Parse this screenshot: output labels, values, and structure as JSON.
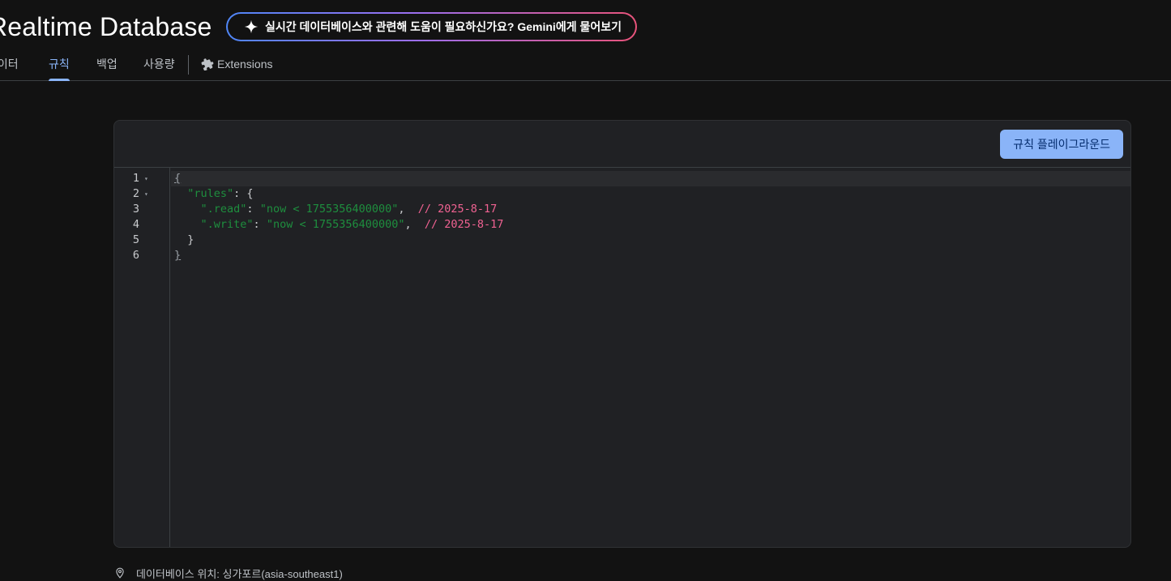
{
  "header": {
    "title": "Realtime Database",
    "gemini_prompt": {
      "icon": "sparkle-icon",
      "text": "실시간 데이터베이스와 관련해 도움이 필요하신가요? Gemini에게 물어보기"
    }
  },
  "tabs": [
    {
      "label": "데이터",
      "active": false
    },
    {
      "label": "규칙",
      "active": true
    },
    {
      "label": "백업",
      "active": false
    },
    {
      "label": "사용량",
      "active": false
    },
    {
      "label": "Extensions",
      "active": false,
      "icon": "puzzle-icon"
    }
  ],
  "toolbar": {
    "playground_label": "규칙 플레이그라운드"
  },
  "editor": {
    "line_numbers": [
      "1",
      "2",
      "3",
      "4",
      "5",
      "6"
    ],
    "foldable_lines": [
      1,
      2
    ],
    "current_line": 1,
    "lines": [
      [
        {
          "t": "{",
          "k": "brace"
        }
      ],
      [
        {
          "t": "  ",
          "k": "punc"
        },
        {
          "t": "\"rules\"",
          "k": "key"
        },
        {
          "t": ": {",
          "k": "punc"
        }
      ],
      [
        {
          "t": "    ",
          "k": "punc"
        },
        {
          "t": "\".read\"",
          "k": "key"
        },
        {
          "t": ": ",
          "k": "punc"
        },
        {
          "t": "\"now < 1755356400000\"",
          "k": "str"
        },
        {
          "t": ",  ",
          "k": "punc"
        },
        {
          "t": "// 2025-8-17",
          "k": "comment"
        }
      ],
      [
        {
          "t": "    ",
          "k": "punc"
        },
        {
          "t": "\".write\"",
          "k": "key"
        },
        {
          "t": ": ",
          "k": "punc"
        },
        {
          "t": "\"now < 1755356400000\"",
          "k": "str"
        },
        {
          "t": ",  ",
          "k": "punc"
        },
        {
          "t": "// 2025-8-17",
          "k": "comment"
        }
      ],
      [
        {
          "t": "  }",
          "k": "punc"
        }
      ],
      [
        {
          "t": "}",
          "k": "brace"
        }
      ]
    ]
  },
  "footer": {
    "icon": "location-pin-icon",
    "location_text": "데이터베이스 위치: 싱가포르(asia-southeast1)"
  },
  "colors": {
    "accent": "#8ab4f8",
    "background": "#121212",
    "card": "#202124",
    "code_string": "#1e8e3e",
    "code_comment": "#f06292"
  }
}
